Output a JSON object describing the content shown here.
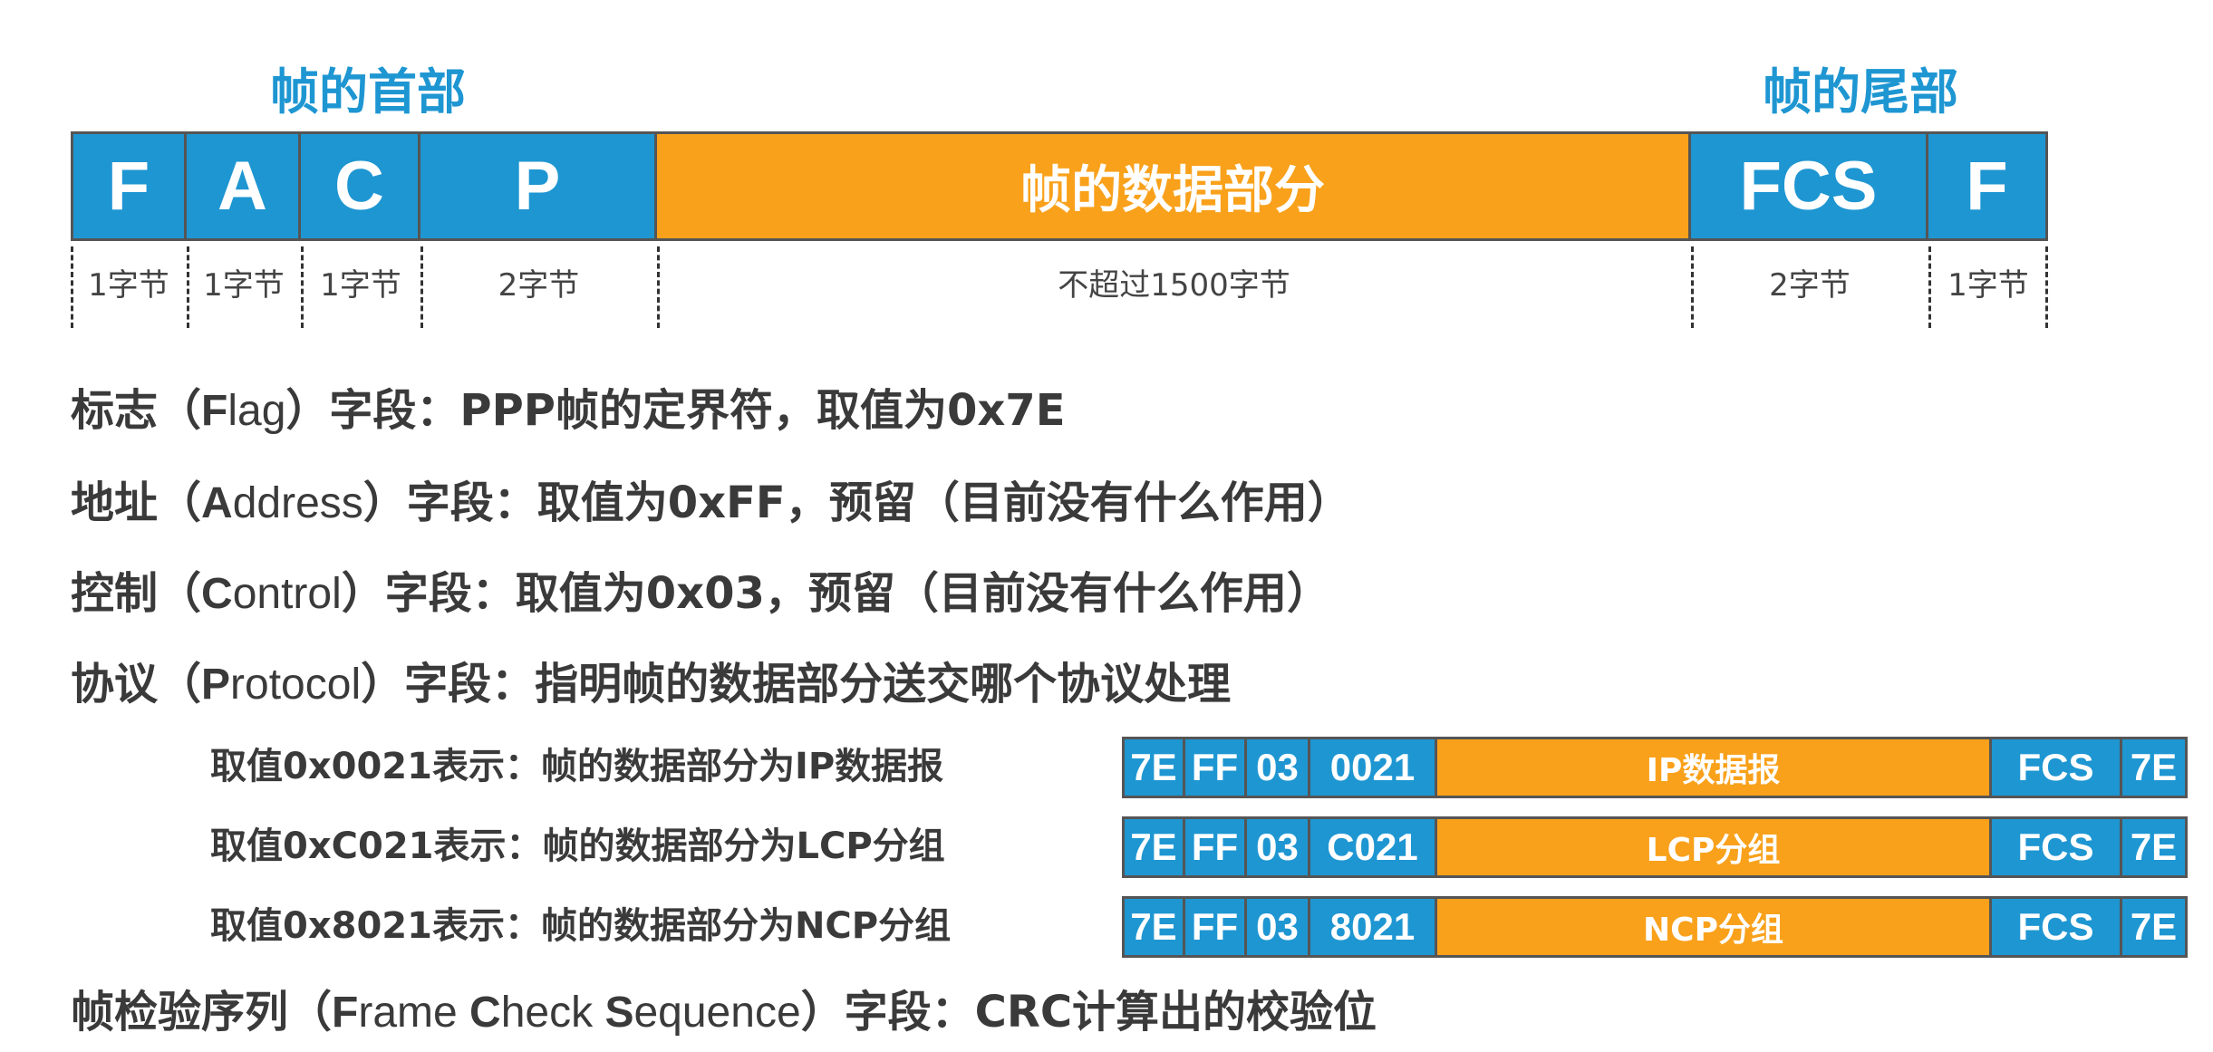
{
  "header_title": "帧的首部",
  "trailer_title": "帧的尾部",
  "frame": {
    "fields": [
      {
        "label": "F",
        "size": "1字节"
      },
      {
        "label": "A",
        "size": "1字节"
      },
      {
        "label": "C",
        "size": "1字节"
      },
      {
        "label": "P",
        "size": "2字节"
      },
      {
        "label": "帧的数据部分",
        "size": "不超过1500字节"
      },
      {
        "label": "FCS",
        "size": "2字节"
      },
      {
        "label": "F",
        "size": "1字节"
      }
    ]
  },
  "descriptions": {
    "flag": {
      "pre": "标志（",
      "en_first": "F",
      "en_rest": "lag",
      "post": "）字段：PPP帧的定界符，取值为0x7E"
    },
    "address": {
      "pre": "地址（",
      "en_first": "A",
      "en_rest": "ddress",
      "post": "）字段：取值为0xFF，预留（目前没有什么作用）"
    },
    "control": {
      "pre": "控制（",
      "en_first": "C",
      "en_rest": "ontrol",
      "post": "）字段：取值为0x03，预留（目前没有什么作用）"
    },
    "protocol": {
      "pre": "协议（",
      "en_first": "P",
      "en_rest": "rotocol",
      "post": "）字段：指明帧的数据部分送交哪个协议处理"
    },
    "fcs": {
      "pre": "帧检验序列（",
      "w1_first": "F",
      "w1_rest": "rame ",
      "w2_first": "C",
      "w2_rest": "heck ",
      "w3_first": "S",
      "w3_rest": "equence",
      "post": "）字段：CRC计算出的校验位"
    }
  },
  "protocol_examples": [
    {
      "text": "取值0x0021表示：帧的数据部分为IP数据报",
      "cells": [
        "7E",
        "FF",
        "03",
        "0021",
        "IP数据报",
        "FCS",
        "7E"
      ]
    },
    {
      "text": "取值0xC021表示：帧的数据部分为LCP分组",
      "cells": [
        "7E",
        "FF",
        "03",
        "C021",
        "LCP分组",
        "FCS",
        "7E"
      ]
    },
    {
      "text": "取值0x8021表示：帧的数据部分为NCP分组",
      "cells": [
        "7E",
        "FF",
        "03",
        "8021",
        "NCP分组",
        "FCS",
        "7E"
      ]
    }
  ],
  "colors": {
    "header_blue": "#1e96d2",
    "data_orange": "#f9a11b",
    "text_dark": "#3a3a3a"
  }
}
